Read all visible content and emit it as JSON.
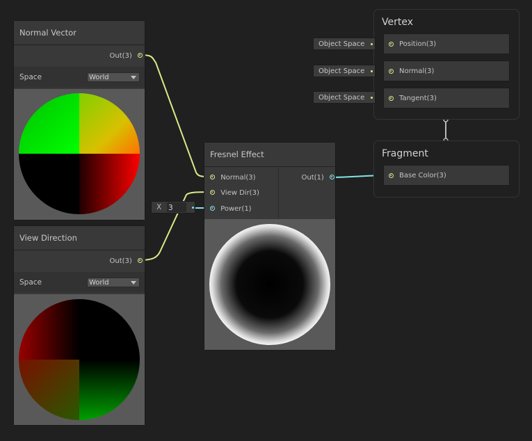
{
  "nodes": {
    "normal_vector": {
      "title": "Normal Vector",
      "output_label": "Out(3)",
      "space_label": "Space",
      "space_value": "World"
    },
    "view_direction": {
      "title": "View Direction",
      "output_label": "Out(3)",
      "space_label": "Space",
      "space_value": "World"
    },
    "fresnel": {
      "title": "Fresnel Effect",
      "inputs": [
        "Normal(3)",
        "View Dir(3)",
        "Power(1)"
      ],
      "output_label": "Out(1)",
      "power_prefix": "X",
      "power_value": "3"
    }
  },
  "master": {
    "vertex": {
      "title": "Vertex",
      "slots": [
        {
          "tag": "Object Space",
          "label": "Position(3)"
        },
        {
          "tag": "Object Space",
          "label": "Normal(3)"
        },
        {
          "tag": "Object Space",
          "label": "Tangent(3)"
        }
      ]
    },
    "fragment": {
      "title": "Fragment",
      "slots": [
        {
          "label": "Base Color(3)"
        }
      ]
    }
  },
  "colors": {
    "background": "#202020",
    "node_body": "#393939",
    "vector3_wire": "#d7ec8a",
    "vector1_wire": "#84e4e7"
  }
}
